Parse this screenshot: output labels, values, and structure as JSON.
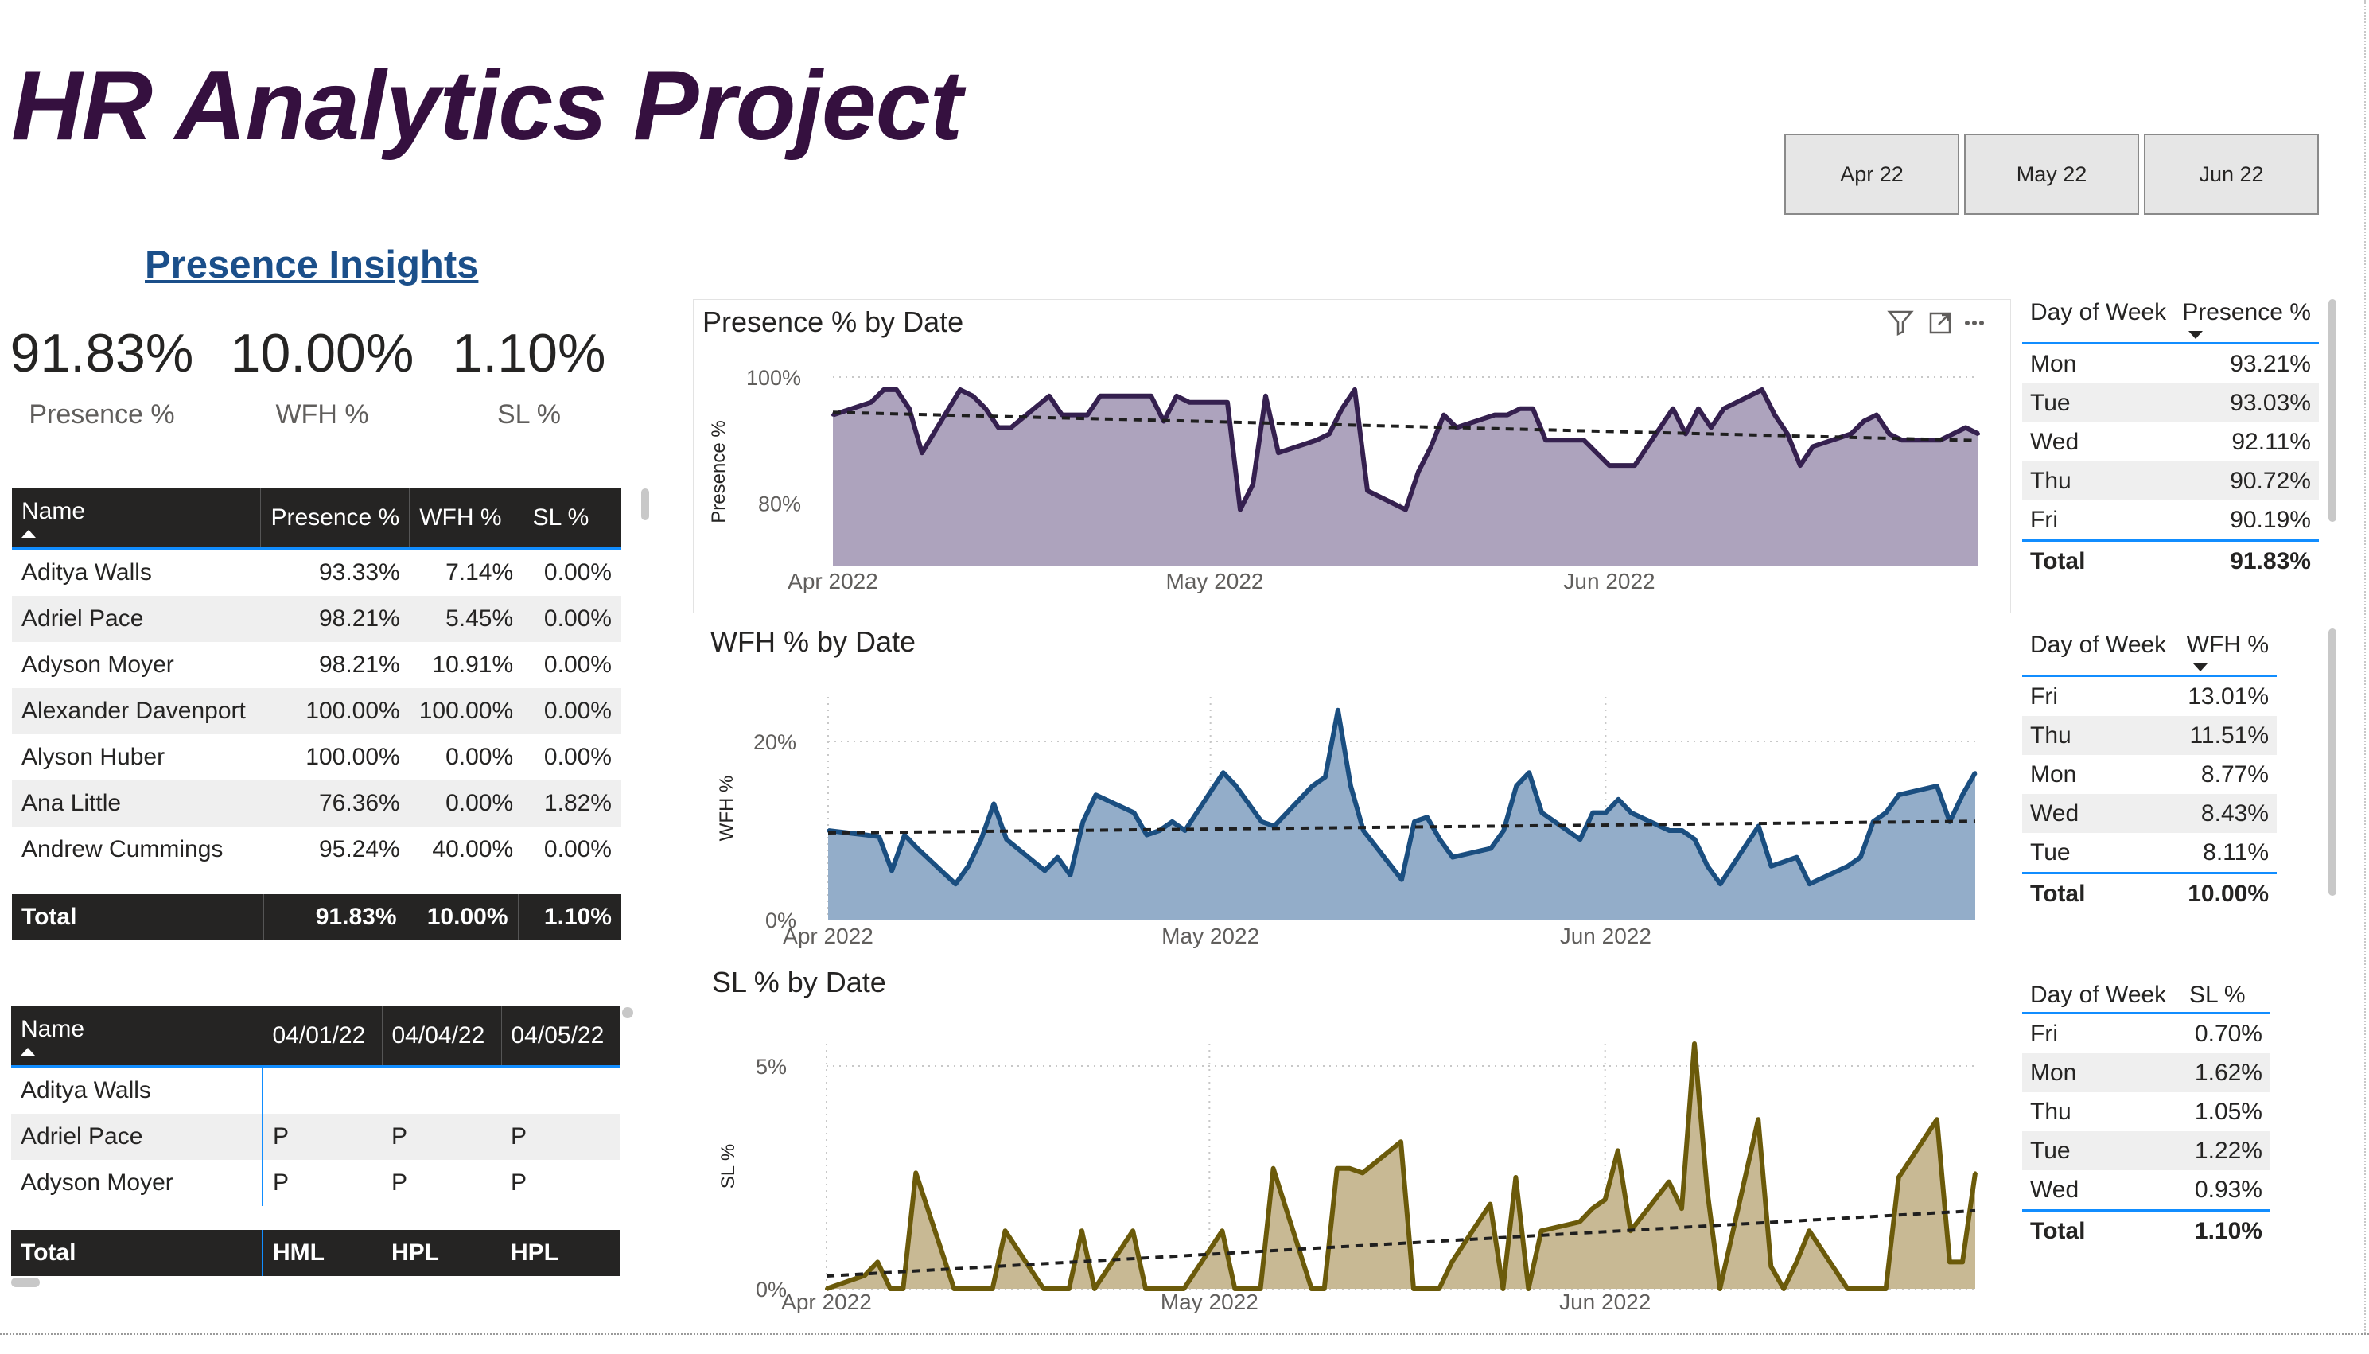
{
  "title": "HR Analytics Project",
  "slicers": [
    "Apr 22",
    "May 22",
    "Jun 22"
  ],
  "section_link": "Presence Insights",
  "kpis": [
    {
      "value": "91.83%",
      "label": "Presence %"
    },
    {
      "value": "10.00%",
      "label": "WFH %"
    },
    {
      "value": "1.10%",
      "label": "SL %"
    }
  ],
  "employee_table": {
    "columns": [
      "Name",
      "Presence %",
      "WFH %",
      "SL %"
    ],
    "rows": [
      [
        "Aditya Walls",
        "93.33%",
        "7.14%",
        "0.00%"
      ],
      [
        "Adriel Pace",
        "98.21%",
        "5.45%",
        "0.00%"
      ],
      [
        "Adyson Moyer",
        "98.21%",
        "10.91%",
        "0.00%"
      ],
      [
        "Alexander Davenport",
        "100.00%",
        "100.00%",
        "0.00%"
      ],
      [
        "Alyson Huber",
        "100.00%",
        "0.00%",
        "0.00%"
      ],
      [
        "Ana Little",
        "76.36%",
        "0.00%",
        "1.82%"
      ],
      [
        "Andrew Cummings",
        "95.24%",
        "40.00%",
        "0.00%"
      ]
    ],
    "total": [
      "Total",
      "91.83%",
      "10.00%",
      "1.10%"
    ]
  },
  "attendance_table": {
    "columns": [
      "Name",
      "04/01/22",
      "04/04/22",
      "04/05/22"
    ],
    "rows": [
      [
        "Aditya Walls",
        "",
        "",
        ""
      ],
      [
        "Adriel Pace",
        "P",
        "P",
        "P"
      ],
      [
        "Adyson Moyer",
        "P",
        "P",
        "P"
      ]
    ],
    "total": [
      "Total",
      "HML",
      "HPL",
      "HPL"
    ]
  },
  "visual_header_icons": [
    "filter-icon",
    "focus-mode-icon",
    "more-options-icon"
  ],
  "colors": {
    "presence": "#35204f",
    "presence_fill": "#ada3bd",
    "wfh": "#1a4e80",
    "wfh_fill": "#93adc9",
    "sl": "#6b5a0a",
    "sl_fill": "#c8b994",
    "title": "#35103f"
  },
  "chart_data": [
    {
      "type": "area",
      "title": "Presence % by Date",
      "ylabel": "Presence %",
      "xlabel": "",
      "x_ticks": [
        "Apr 2022",
        "May 2022",
        "Jun 2022"
      ],
      "y_ticks": [
        "100%",
        "80%"
      ],
      "x_range": [
        "2022-04-01",
        "2022-06-30"
      ],
      "ylim": [
        70,
        100
      ],
      "trendline": true,
      "grid": true,
      "x": [
        "2022-04-01",
        "2022-04-04",
        "2022-04-05",
        "2022-04-06",
        "2022-04-07",
        "2022-04-08",
        "2022-04-11",
        "2022-04-12",
        "2022-04-13",
        "2022-04-14",
        "2022-04-15",
        "2022-04-18",
        "2022-04-19",
        "2022-04-20",
        "2022-04-21",
        "2022-04-22",
        "2022-04-25",
        "2022-04-26",
        "2022-04-27",
        "2022-04-28",
        "2022-04-29",
        "2022-05-02",
        "2022-05-03",
        "2022-05-04",
        "2022-05-05",
        "2022-05-06",
        "2022-05-09",
        "2022-05-10",
        "2022-05-11",
        "2022-05-12",
        "2022-05-13",
        "2022-05-16",
        "2022-05-17",
        "2022-05-18",
        "2022-05-19",
        "2022-05-20",
        "2022-05-23",
        "2022-05-24",
        "2022-05-25",
        "2022-05-26",
        "2022-05-27",
        "2022-05-30",
        "2022-05-31",
        "2022-06-01",
        "2022-06-02",
        "2022-06-03",
        "2022-06-06",
        "2022-06-07",
        "2022-06-08",
        "2022-06-09",
        "2022-06-10",
        "2022-06-13",
        "2022-06-14",
        "2022-06-15",
        "2022-06-16",
        "2022-06-17",
        "2022-06-20",
        "2022-06-21",
        "2022-06-22",
        "2022-06-23",
        "2022-06-24",
        "2022-06-27",
        "2022-06-28",
        "2022-06-29",
        "2022-06-30"
      ],
      "series": [
        {
          "values": [
            94,
            96,
            98,
            98,
            95,
            88,
            98,
            97,
            95,
            92,
            92,
            97,
            94,
            94,
            94,
            97,
            97,
            97,
            93,
            97,
            96,
            96,
            79,
            83,
            97,
            88,
            90,
            91,
            95,
            98,
            82,
            79,
            85,
            89,
            94,
            92,
            94,
            94,
            95,
            95,
            90,
            90,
            88,
            86,
            86,
            86,
            95,
            91,
            95,
            92,
            95,
            98,
            94,
            91,
            86,
            89,
            91,
            93,
            94,
            91,
            90,
            90,
            91,
            92,
            91
          ]
        }
      ]
    },
    {
      "type": "area",
      "title": "WFH % by Date",
      "ylabel": "WFH %",
      "xlabel": "",
      "x_ticks": [
        "Apr 2022",
        "May 2022",
        "Jun 2022"
      ],
      "y_ticks": [
        "20%",
        "0%"
      ],
      "x_range": [
        "2022-04-01",
        "2022-06-30"
      ],
      "ylim": [
        0,
        25
      ],
      "trendline": true,
      "grid": true,
      "x": [
        "2022-04-01",
        "2022-04-04",
        "2022-04-05",
        "2022-04-06",
        "2022-04-07",
        "2022-04-08",
        "2022-04-11",
        "2022-04-12",
        "2022-04-13",
        "2022-04-14",
        "2022-04-15",
        "2022-04-18",
        "2022-04-19",
        "2022-04-20",
        "2022-04-21",
        "2022-04-22",
        "2022-04-25",
        "2022-04-26",
        "2022-04-27",
        "2022-04-28",
        "2022-04-29",
        "2022-05-02",
        "2022-05-03",
        "2022-05-04",
        "2022-05-05",
        "2022-05-06",
        "2022-05-09",
        "2022-05-10",
        "2022-05-11",
        "2022-05-12",
        "2022-05-13",
        "2022-05-16",
        "2022-05-17",
        "2022-05-18",
        "2022-05-19",
        "2022-05-20",
        "2022-05-23",
        "2022-05-24",
        "2022-05-25",
        "2022-05-26",
        "2022-05-27",
        "2022-05-30",
        "2022-05-31",
        "2022-06-01",
        "2022-06-02",
        "2022-06-03",
        "2022-06-06",
        "2022-06-07",
        "2022-06-08",
        "2022-06-09",
        "2022-06-10",
        "2022-06-13",
        "2022-06-14",
        "2022-06-15",
        "2022-06-16",
        "2022-06-17",
        "2022-06-20",
        "2022-06-21",
        "2022-06-22",
        "2022-06-23",
        "2022-06-24",
        "2022-06-27",
        "2022-06-28",
        "2022-06-29",
        "2022-06-30"
      ],
      "series": [
        {
          "values": [
            10,
            9.5,
            9.3,
            5.5,
            9.5,
            8,
            4,
            6,
            9,
            13,
            9,
            5.5,
            7,
            5,
            11,
            14,
            12,
            9.5,
            10,
            11,
            10,
            16.5,
            15,
            13,
            11,
            10.5,
            15,
            16,
            23.5,
            15,
            10,
            4.5,
            11,
            11.5,
            9,
            7,
            8,
            10,
            15,
            16.5,
            12,
            9,
            12,
            12,
            13.5,
            12,
            10,
            10,
            9,
            6,
            4,
            10.5,
            6,
            6.5,
            7,
            4,
            6,
            7,
            11,
            12,
            14,
            15,
            11,
            14,
            16.5
          ]
        }
      ]
    },
    {
      "type": "area",
      "title": "SL % by Date",
      "ylabel": "SL %",
      "xlabel": "",
      "x_ticks": [
        "Apr 2022",
        "May 2022",
        "Jun 2022"
      ],
      "y_ticks": [
        "5%",
        "0%"
      ],
      "x_range": [
        "2022-04-01",
        "2022-06-30"
      ],
      "ylim": [
        0,
        5.5
      ],
      "trendline": true,
      "grid": true,
      "x": [
        "2022-04-01",
        "2022-04-04",
        "2022-04-05",
        "2022-04-06",
        "2022-04-07",
        "2022-04-08",
        "2022-04-11",
        "2022-04-12",
        "2022-04-13",
        "2022-04-14",
        "2022-04-15",
        "2022-04-18",
        "2022-04-19",
        "2022-04-20",
        "2022-04-21",
        "2022-04-22",
        "2022-04-25",
        "2022-04-26",
        "2022-04-27",
        "2022-04-28",
        "2022-04-29",
        "2022-05-02",
        "2022-05-03",
        "2022-05-04",
        "2022-05-05",
        "2022-05-06",
        "2022-05-09",
        "2022-05-10",
        "2022-05-11",
        "2022-05-12",
        "2022-05-13",
        "2022-05-16",
        "2022-05-17",
        "2022-05-18",
        "2022-05-19",
        "2022-05-20",
        "2022-05-23",
        "2022-05-24",
        "2022-05-25",
        "2022-05-26",
        "2022-05-27",
        "2022-05-30",
        "2022-05-31",
        "2022-06-01",
        "2022-06-02",
        "2022-06-03",
        "2022-06-06",
        "2022-06-07",
        "2022-06-08",
        "2022-06-09",
        "2022-06-10",
        "2022-06-13",
        "2022-06-14",
        "2022-06-15",
        "2022-06-16",
        "2022-06-17",
        "2022-06-20",
        "2022-06-21",
        "2022-06-22",
        "2022-06-23",
        "2022-06-24",
        "2022-06-27",
        "2022-06-28",
        "2022-06-29",
        "2022-06-30"
      ],
      "series": [
        {
          "values": [
            0,
            0.3,
            0.6,
            0,
            0,
            2.6,
            0,
            0,
            0,
            0,
            1.3,
            0,
            0,
            0,
            1.3,
            0,
            1.3,
            0,
            0,
            0,
            0,
            1.3,
            0,
            0,
            0,
            2.7,
            0,
            0,
            2.7,
            2.7,
            2.6,
            3.3,
            0,
            0,
            0,
            0.6,
            1.9,
            0,
            2.5,
            0,
            1.3,
            1.5,
            1.8,
            2,
            3.1,
            1.3,
            2.4,
            1.8,
            5.5,
            2.2,
            0,
            3.8,
            0.5,
            0,
            0.6,
            1.3,
            0,
            0,
            0,
            0,
            2.5,
            3.8,
            0.6,
            0.6,
            2.6
          ]
        }
      ]
    }
  ],
  "day_tables": [
    {
      "columns": [
        "Day of Week",
        "Presence %"
      ],
      "rows": [
        [
          "Mon",
          "93.21%"
        ],
        [
          "Tue",
          "93.03%"
        ],
        [
          "Wed",
          "92.11%"
        ],
        [
          "Thu",
          "90.72%"
        ],
        [
          "Fri",
          "90.19%"
        ]
      ],
      "total": [
        "Total",
        "91.83%"
      ]
    },
    {
      "columns": [
        "Day of Week",
        "WFH %"
      ],
      "rows": [
        [
          "Fri",
          "13.01%"
        ],
        [
          "Thu",
          "11.51%"
        ],
        [
          "Mon",
          "8.77%"
        ],
        [
          "Wed",
          "8.43%"
        ],
        [
          "Tue",
          "8.11%"
        ]
      ],
      "total": [
        "Total",
        "10.00%"
      ]
    },
    {
      "columns": [
        "Day of Week",
        "SL %"
      ],
      "rows": [
        [
          "Fri",
          "0.70%"
        ],
        [
          "Mon",
          "1.62%"
        ],
        [
          "Thu",
          "1.05%"
        ],
        [
          "Tue",
          "1.22%"
        ],
        [
          "Wed",
          "0.93%"
        ]
      ],
      "total": [
        "Total",
        "1.10%"
      ]
    }
  ]
}
